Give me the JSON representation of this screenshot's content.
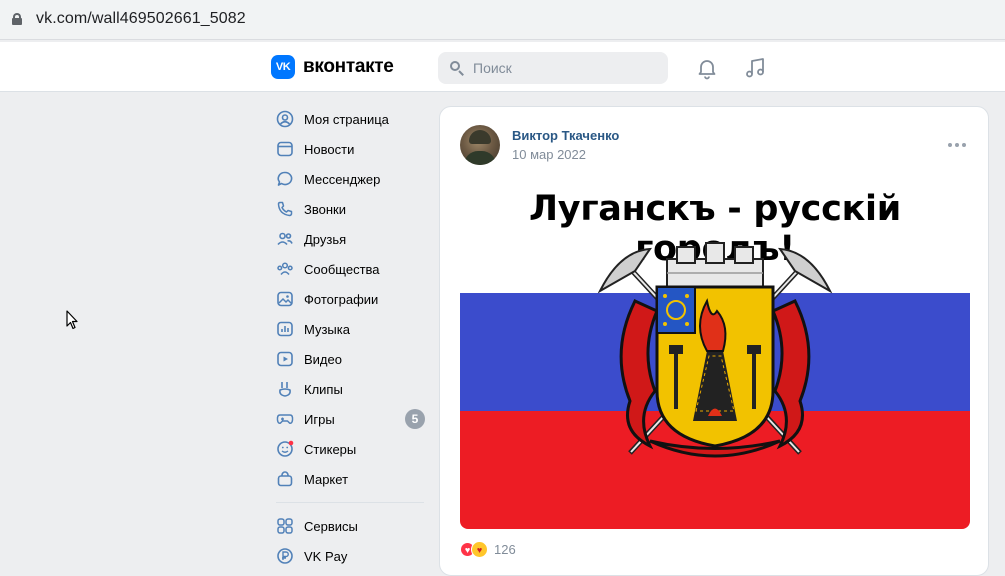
{
  "browser": {
    "url": "vk.com/wall469502661_5082"
  },
  "header": {
    "logo_mark": "VK",
    "logo_text": "вконтакте",
    "search_placeholder": "Поиск",
    "accent": "#0077ff"
  },
  "nav": {
    "items": [
      {
        "label": "Моя страница",
        "icon": "user-icon"
      },
      {
        "label": "Новости",
        "icon": "news-icon"
      },
      {
        "label": "Мессенджер",
        "icon": "message-icon"
      },
      {
        "label": "Звонки",
        "icon": "phone-icon"
      },
      {
        "label": "Друзья",
        "icon": "friends-icon"
      },
      {
        "label": "Сообщества",
        "icon": "communities-icon"
      },
      {
        "label": "Фотографии",
        "icon": "photos-icon"
      },
      {
        "label": "Музыка",
        "icon": "music-icon"
      },
      {
        "label": "Видео",
        "icon": "video-icon"
      },
      {
        "label": "Клипы",
        "icon": "clips-icon"
      },
      {
        "label": "Игры",
        "icon": "games-icon",
        "badge": "5"
      },
      {
        "label": "Стикеры",
        "icon": "stickers-icon"
      },
      {
        "label": "Маркет",
        "icon": "market-icon"
      }
    ],
    "secondary": [
      {
        "label": "Сервисы",
        "icon": "services-icon"
      },
      {
        "label": "VK Pay",
        "icon": "vkpay-icon"
      }
    ]
  },
  "post": {
    "author": "Виктор Ткаченко",
    "date": "10 мар 2022",
    "image_title": "Луганскъ - русскій городъ!",
    "flag_colors": {
      "white": "#ffffff",
      "blue": "#3b4ccc",
      "red": "#ed1c24"
    },
    "reactions_count": "126"
  }
}
